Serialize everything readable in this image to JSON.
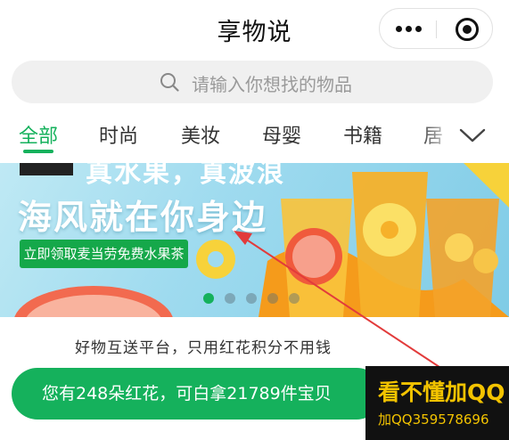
{
  "app": {
    "title": "享物说"
  },
  "capsule": {
    "more_icon": "more-dots-icon",
    "close_icon": "target-close-icon"
  },
  "search": {
    "placeholder": "请输入你想找的物品",
    "icon": "search-icon"
  },
  "tabs": [
    {
      "label": "全部",
      "active": true
    },
    {
      "label": "时尚"
    },
    {
      "label": "美妆"
    },
    {
      "label": "母婴"
    },
    {
      "label": "书籍"
    },
    {
      "label": "居"
    }
  ],
  "banner": {
    "title_top": "真水果，真波浪",
    "title": "海风就在你身边",
    "cta": "立即领取麦当劳免费水果茶",
    "dot_count": 5,
    "active_dot": 0
  },
  "platform": {
    "tagline": "好物互送平台，只用红花积分不用钱"
  },
  "cta": {
    "text": "您有248朵红花，可白拿21789件宝贝"
  },
  "watermark": {
    "line1": "看不懂加QQ",
    "line2": "加QQ359578696"
  },
  "colors": {
    "accent": "#15b15c",
    "watermark_text": "#f3c300",
    "annotation_arrow": "#e23b3b"
  }
}
